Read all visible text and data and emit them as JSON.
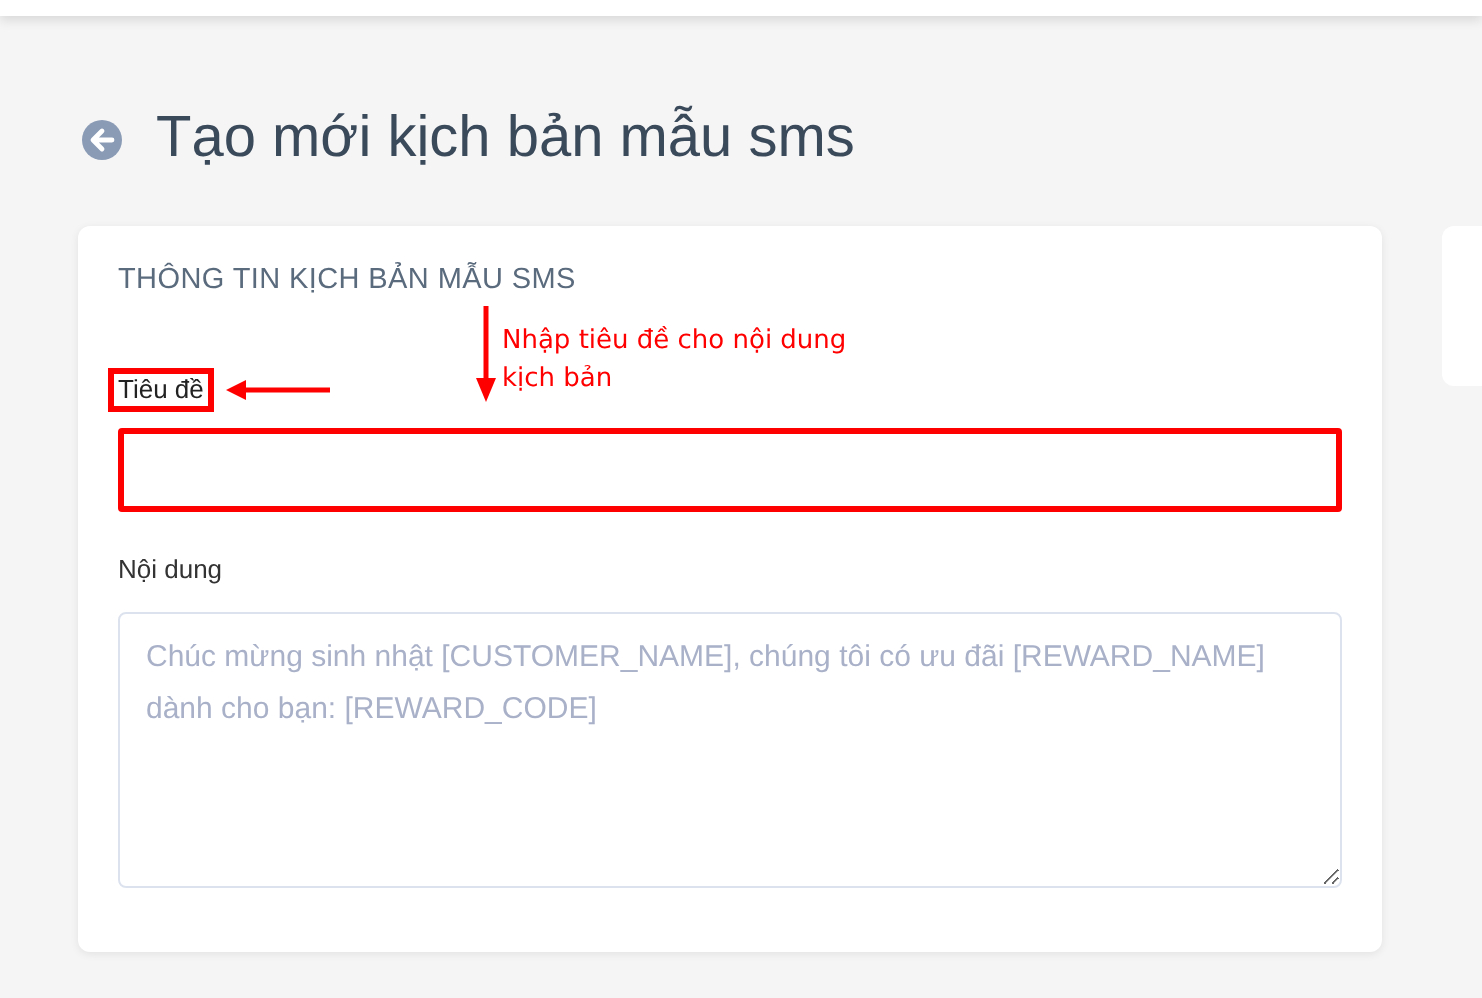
{
  "page_title": "Tạo mới kịch bản mẫu sms",
  "card": {
    "heading": "THÔNG TIN KỊCH BẢN MẪU SMS",
    "fields": [
      {
        "kind": "text",
        "label": "Tiêu đề",
        "highlighted": true
      },
      {
        "kind": "textarea",
        "label": "Nội dung",
        "placeholder": "Chúc mừng sinh nhật [CUSTOMER_NAME], chúng tôi có ưu đãi [REWARD_NAME] dành cho bạn: [REWARD_CODE]",
        "highlighted": false
      }
    ]
  },
  "annotation": {
    "text": "Nhập tiêu đề cho nội dung kịch bản"
  }
}
